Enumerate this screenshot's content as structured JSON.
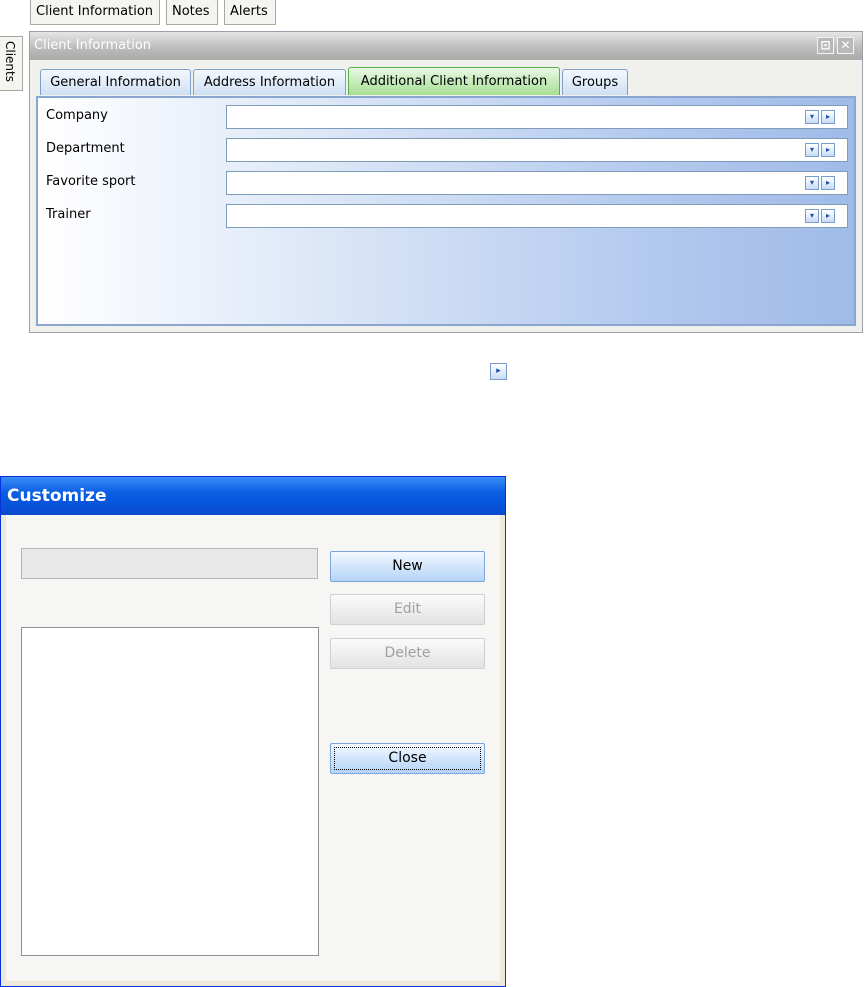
{
  "top_buttons": [
    "Client Information",
    "Notes",
    "Alerts"
  ],
  "side_tab": "Clients",
  "panel": {
    "title": "Client Information",
    "tabs": [
      {
        "label": "General Information",
        "active": false
      },
      {
        "label": "Address Information",
        "active": false
      },
      {
        "label": "Additional Client Information",
        "active": true
      },
      {
        "label": "Groups",
        "active": false
      }
    ],
    "fields": [
      {
        "label": "Company",
        "value": ""
      },
      {
        "label": "Department",
        "value": ""
      },
      {
        "label": "Favorite sport",
        "value": ""
      },
      {
        "label": "Trainer",
        "value": ""
      }
    ]
  },
  "icons": {
    "dropdown": "▾",
    "arrow": "▸",
    "pin": "⊡",
    "close": "✕"
  },
  "dialog": {
    "title": "Customize",
    "text_value": "",
    "buttons": {
      "new": "New",
      "edit": "Edit",
      "delete": "Delete",
      "close": "Close"
    }
  },
  "colors": {
    "active_tab": "#a6df93",
    "tab": "#cfe0f4",
    "dialog_titlebar": "#0b5fe3"
  }
}
